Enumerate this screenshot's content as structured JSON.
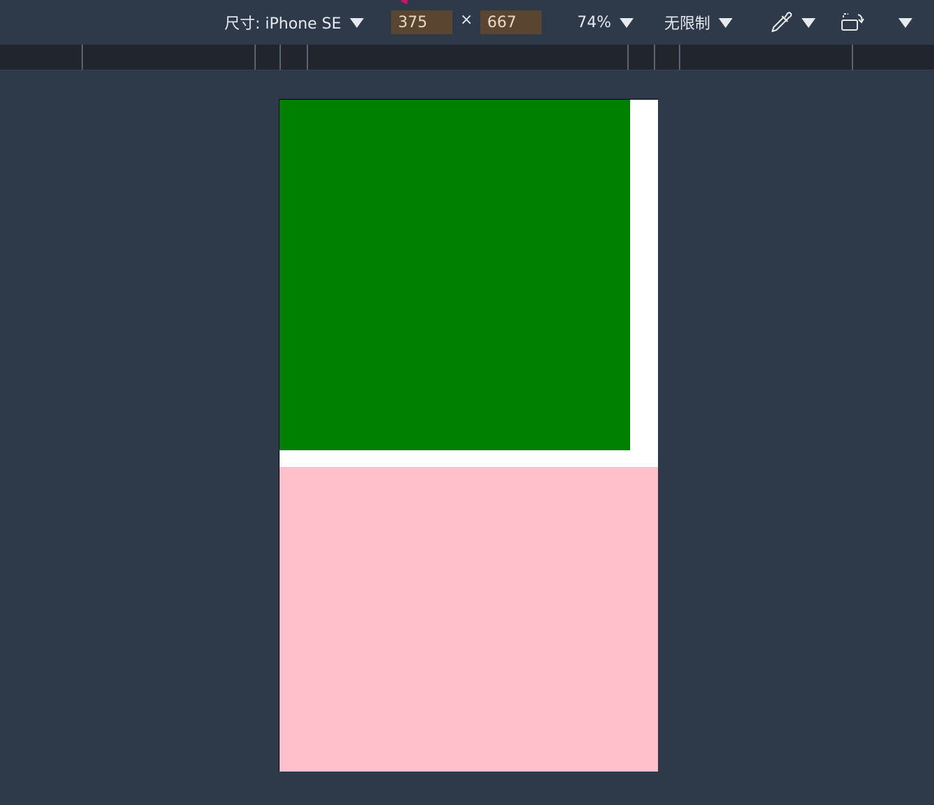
{
  "toolbar": {
    "device_label": "尺寸: iPhone SE",
    "width_value": "375",
    "times_symbol": "×",
    "height_value": "667",
    "zoom_label": "74%",
    "throttle_label": "无限制"
  },
  "viewport": {
    "green_color": "#008000",
    "pink_color": "#ffc0cb"
  }
}
